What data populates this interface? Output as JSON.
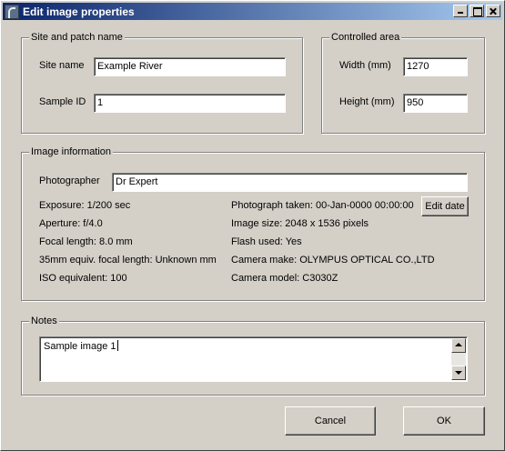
{
  "window": {
    "title": "Edit image properties"
  },
  "site_patch": {
    "legend": "Site and patch name",
    "site_name_label": "Site name",
    "site_name_value": "Example River",
    "sample_id_label": "Sample ID",
    "sample_id_value": "1"
  },
  "controlled_area": {
    "legend": "Controlled area",
    "width_label": "Width (mm)",
    "width_value": "1270",
    "height_label": "Height (mm)",
    "height_value": "950"
  },
  "image_info": {
    "legend": "Image information",
    "photographer_label": "Photographer",
    "photographer_value": "Dr Expert",
    "exposure": "Exposure: 1/200 sec",
    "aperture": "Aperture: f/4.0",
    "focal_length": "Focal length: 8.0 mm",
    "focal_35mm": "35mm equiv. focal length: Unknown mm",
    "iso": "ISO equivalent: 100",
    "photo_taken": "Photograph taken: 00-Jan-0000 00:00:00",
    "image_size": "Image size: 2048 x 1536 pixels",
    "flash": "Flash used: Yes",
    "camera_make": "Camera make: OLYMPUS OPTICAL CO.,LTD",
    "camera_model": "Camera model: C3030Z",
    "edit_date_button": "Edit date"
  },
  "notes": {
    "legend": "Notes",
    "value": "Sample image 1"
  },
  "buttons": {
    "cancel": "Cancel",
    "ok": "OK"
  }
}
